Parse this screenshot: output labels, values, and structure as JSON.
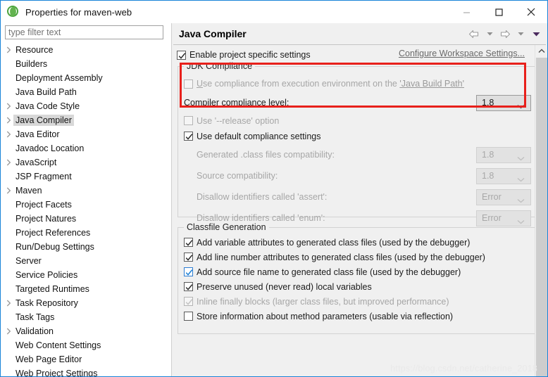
{
  "window": {
    "title": "Properties for maven-web",
    "icon": "eclipse-icon",
    "minimize_label": "Minimize",
    "maximize_label": "Maximize",
    "close_label": "Close"
  },
  "sidebar": {
    "filter_placeholder": "type filter text",
    "items": [
      {
        "label": "Resource",
        "expandable": true,
        "selected": false
      },
      {
        "label": "Builders",
        "expandable": false,
        "selected": false
      },
      {
        "label": "Deployment Assembly",
        "expandable": false,
        "selected": false
      },
      {
        "label": "Java Build Path",
        "expandable": false,
        "selected": false
      },
      {
        "label": "Java Code Style",
        "expandable": true,
        "selected": false
      },
      {
        "label": "Java Compiler",
        "expandable": true,
        "selected": true
      },
      {
        "label": "Java Editor",
        "expandable": true,
        "selected": false
      },
      {
        "label": "Javadoc Location",
        "expandable": false,
        "selected": false
      },
      {
        "label": "JavaScript",
        "expandable": true,
        "selected": false
      },
      {
        "label": "JSP Fragment",
        "expandable": false,
        "selected": false
      },
      {
        "label": "Maven",
        "expandable": true,
        "selected": false
      },
      {
        "label": "Project Facets",
        "expandable": false,
        "selected": false
      },
      {
        "label": "Project Natures",
        "expandable": false,
        "selected": false
      },
      {
        "label": "Project References",
        "expandable": false,
        "selected": false
      },
      {
        "label": "Run/Debug Settings",
        "expandable": false,
        "selected": false
      },
      {
        "label": "Server",
        "expandable": false,
        "selected": false
      },
      {
        "label": "Service Policies",
        "expandable": false,
        "selected": false
      },
      {
        "label": "Targeted Runtimes",
        "expandable": false,
        "selected": false
      },
      {
        "label": "Task Repository",
        "expandable": true,
        "selected": false
      },
      {
        "label": "Task Tags",
        "expandable": false,
        "selected": false
      },
      {
        "label": "Validation",
        "expandable": true,
        "selected": false
      },
      {
        "label": "Web Content Settings",
        "expandable": false,
        "selected": false
      },
      {
        "label": "Web Page Editor",
        "expandable": false,
        "selected": false
      },
      {
        "label": "Web Project Settings",
        "expandable": false,
        "selected": false
      }
    ]
  },
  "main": {
    "title": "Java Compiler",
    "nav": {
      "back": "back-arrow",
      "back_menu": "back-dropdown",
      "forward": "forward-arrow",
      "forward_menu": "forward-dropdown",
      "view_menu": "view-menu"
    },
    "enable_project_specific": {
      "label": "Enable project specific settings",
      "checked": true
    },
    "configure_workspace_link": "Configure Workspace Settings...",
    "jdk_compliance": {
      "legend": "JDK Compliance",
      "use_execution_env": {
        "label_prefix": "Use compliance from execution environment on the ",
        "label_link": "'Java Build Path'",
        "checked": false,
        "enabled": false
      },
      "compliance_level": {
        "label": "Compiler compliance level:",
        "value": "1.8",
        "enabled": true
      },
      "use_release_option": {
        "label": "Use '--release' option",
        "checked": false,
        "enabled": false
      },
      "use_default_compliance": {
        "label": "Use default compliance settings",
        "checked": true,
        "enabled": true
      },
      "fields": [
        {
          "label": "Generated .class files compatibility:",
          "value": "1.8",
          "enabled": false
        },
        {
          "label": "Source compatibility:",
          "value": "1.8",
          "enabled": false
        },
        {
          "label": "Disallow identifiers called 'assert':",
          "value": "Error",
          "enabled": false
        },
        {
          "label": "Disallow identifiers called 'enum':",
          "value": "Error",
          "enabled": false
        }
      ]
    },
    "classfile_generation": {
      "legend": "Classfile Generation",
      "options": [
        {
          "label": "Add variable attributes to generated class files (used by the debugger)",
          "checked": true,
          "enabled": true,
          "focused": false
        },
        {
          "label": "Add line number attributes to generated class files (used by the debugger)",
          "checked": true,
          "enabled": true,
          "focused": false
        },
        {
          "label": "Add source file name to generated class file (used by the debugger)",
          "checked": true,
          "enabled": true,
          "focused": true
        },
        {
          "label": "Preserve unused (never read) local variables",
          "checked": true,
          "enabled": true,
          "focused": false
        },
        {
          "label": "Inline finally blocks (larger class files, but improved performance)",
          "checked": true,
          "enabled": false,
          "focused": false
        },
        {
          "label": "Store information about method parameters (usable via reflection)",
          "checked": false,
          "enabled": true,
          "focused": false
        }
      ]
    },
    "highlight_color": "#e8201b"
  },
  "watermark": "https://blog.csdn.net/catherine_2018"
}
